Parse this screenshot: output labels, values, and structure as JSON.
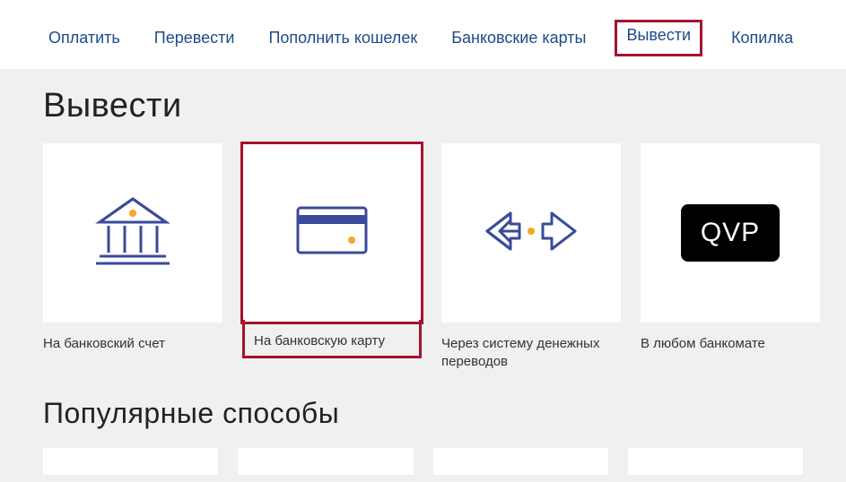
{
  "nav": {
    "items": [
      {
        "label": "Оплатить"
      },
      {
        "label": "Перевести"
      },
      {
        "label": "Пополнить кошелек"
      },
      {
        "label": "Банковские карты"
      },
      {
        "label": "Вывести",
        "highlighted": true
      },
      {
        "label": "Копилка"
      }
    ]
  },
  "headings": {
    "withdraw": "Вывести",
    "popular": "Популярные способы"
  },
  "tiles": [
    {
      "label": "На банковский счет",
      "icon": "bank-icon"
    },
    {
      "label": "На банковскую карту",
      "icon": "card-icon",
      "highlighted": true
    },
    {
      "label": "Через систему денежных переводов",
      "icon": "transfer-arrows-icon"
    },
    {
      "label": "В любом банкомате",
      "icon": "qvp-icon",
      "badge": "QVP"
    }
  ],
  "colors": {
    "link": "#1e4a8a",
    "highlight": "#a5132f",
    "iconStroke": "#3b4a9b",
    "accentDot": "#f5a623"
  }
}
